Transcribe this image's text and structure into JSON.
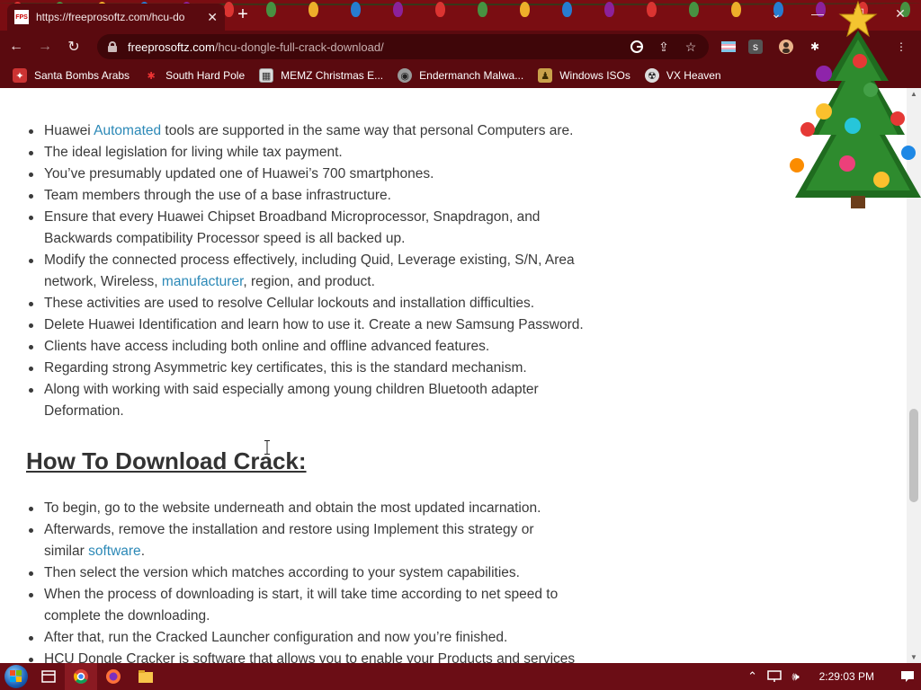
{
  "browser": {
    "tab": {
      "title": "https://freeprosoftz.com/hcu-do",
      "favicon_text": "FPS"
    },
    "window_controls": [
      "chevron-down-icon",
      "minimize-icon",
      "maximize-icon",
      "close-icon"
    ],
    "url": {
      "host": "freeprosoftz.com",
      "path": "/hcu-dongle-full-crack-download/"
    }
  },
  "bookmarks": [
    {
      "label": "Santa Bombs Arabs",
      "icon": "santa-icon"
    },
    {
      "label": "South Hard Pole",
      "icon": "snowflake-icon"
    },
    {
      "label": "MEMZ Christmas E...",
      "icon": "image-icon"
    },
    {
      "label": "Endermanch Malwa...",
      "icon": "wolf-icon"
    },
    {
      "label": "Windows ISOs",
      "icon": "figure-icon"
    },
    {
      "label": "VX Heaven",
      "icon": "vx-icon"
    }
  ],
  "article": {
    "features": [
      {
        "before": "Huawei ",
        "link": "Automated",
        "after": " tools are supported in the same way that personal Computers are."
      },
      {
        "text": "The ideal legislation for living while tax payment."
      },
      {
        "text": "You’ve presumably updated one of Huawei’s 700 smartphones."
      },
      {
        "text": "Team members through the use of a base infrastructure."
      },
      {
        "line1": "Ensure that every Huawei Chipset Broadband Microprocessor, Snapdragon, and",
        "line2": "Backwards compatibility Processor speed is all backed up."
      },
      {
        "line1": "Modify the connected process effectively, including Quid, Leverage existing, S/N, Area",
        "before2": "network, Wireless, ",
        "link": "manufacturer",
        "after2": ", region, and product."
      },
      {
        "text": "These activities are used to resolve Cellular lockouts and installation difficulties."
      },
      {
        "text": "Delete Huawei Identification and learn how to use it. Create a new Samsung Password."
      },
      {
        "text": "Clients have access including both online and offline advanced features."
      },
      {
        "text": "Regarding strong Asymmetric key certificates, this is the standard mechanism."
      },
      {
        "line1": "Along with working with said especially among young children Bluetooth adapter",
        "line2": "Deformation."
      }
    ],
    "download_heading": "How To Download Crack:",
    "download_steps": [
      {
        "text": "To begin, go to the website underneath and obtain the most updated incarnation."
      },
      {
        "line1": "Afterwards, remove the installation and restore using Implement this strategy or",
        "before2": "similar ",
        "link": "software",
        "after2": "."
      },
      {
        "text": "Then select the version which matches according to your system capabilities."
      },
      {
        "line1": "When the process of downloading is start, it will take time according to net speed to",
        "line2": "complete the downloading."
      },
      {
        "text": "After that, run the Cracked Launcher configuration and now you’re finished."
      },
      {
        "text": "HCU Dongle Cracker is software that allows you to enable your Products and services"
      }
    ]
  },
  "taskbar": {
    "clock": "2:29:03 PM",
    "tray_icons": [
      "chevron-up-icon",
      "network-icon",
      "volume-icon"
    ],
    "apps": [
      "task-view-icon",
      "chrome-icon",
      "firefox-icon",
      "file-explorer-icon"
    ]
  },
  "colors": {
    "link": "#2c89b7",
    "chrome_frame": "#5a0a0f",
    "taskbar": "#6b0d15"
  }
}
